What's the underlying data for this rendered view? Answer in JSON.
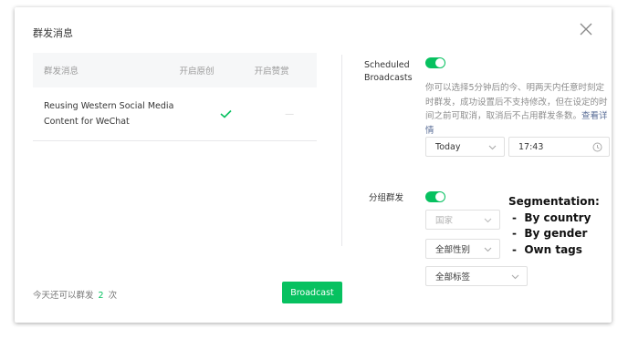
{
  "dialog": {
    "title": "群发消息"
  },
  "table": {
    "headers": {
      "message": "群发消息",
      "original": "开启原创",
      "reward": "开启赞赏"
    },
    "rows": [
      {
        "message": "Reusing Western Social Media Content for WeChat",
        "original_enabled": true,
        "reward": "—"
      }
    ]
  },
  "footer": {
    "remaining_prefix": "今天还可以群发",
    "remaining_count": "2",
    "remaining_suffix": "次",
    "broadcast_label": "Broadcast"
  },
  "scheduled": {
    "label": "Scheduled Broadcasts",
    "toggle_on": true,
    "description": "你可以选择5分钟后的今、明两天内任意时刻定时群发，成功设置后不支持修改，但在设定的时间之前可取消，取消后不占用群发条数。",
    "link": "查看详情",
    "date_value": "Today",
    "time_value": "17:43"
  },
  "segmentation": {
    "label": "分组群发",
    "toggle_on": true,
    "country_placeholder": "国家",
    "gender_value": "全部性别",
    "tags_value": "全部标签"
  },
  "annotation": {
    "title": "Segmentation:",
    "items": [
      "By country",
      "By gender",
      "Own tags"
    ]
  },
  "colors": {
    "accent": "#07c160",
    "link": "#576b95"
  }
}
